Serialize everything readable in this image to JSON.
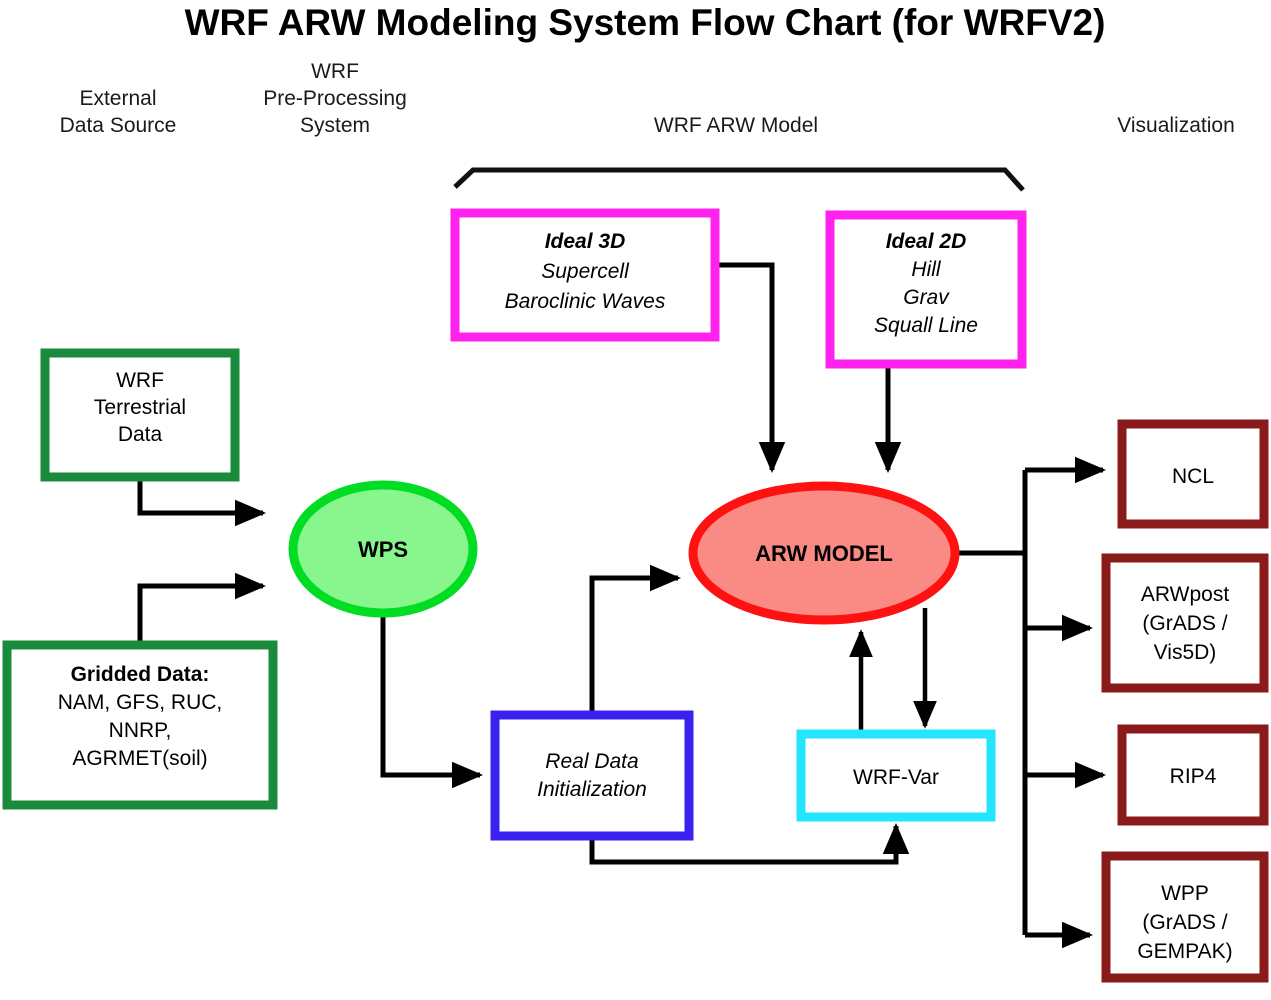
{
  "title": "WRF ARW Modeling System Flow Chart (for WRFV2)",
  "columns": [
    {
      "id": "external-data-source",
      "lines": [
        "External",
        "Data Source"
      ]
    },
    {
      "id": "wrf-pre-processing-system",
      "lines": [
        "WRF",
        "Pre-Processing",
        "System"
      ]
    },
    {
      "id": "wrf-arw-model",
      "lines": [
        "WRF ARW Model"
      ]
    },
    {
      "id": "visualization",
      "lines": [
        "Visualization"
      ]
    }
  ],
  "nodes": {
    "wrf_terrestrial_data": {
      "label": "WRF Terrestrial Data",
      "lines": [
        "WRF",
        "Terrestrial",
        "Data"
      ],
      "shape": "box",
      "border_color": "#1a8a3d",
      "fill_color": "#ffffff",
      "text_color": "#000000"
    },
    "gridded_data": {
      "label": "Gridded Data",
      "lines": [
        "Gridded Data:",
        "NAM, GFS, RUC,",
        "NNRP,",
        "AGRMET(soil)"
      ],
      "bold_lines": [
        0
      ],
      "shape": "box",
      "border_color": "#1a8a3d",
      "fill_color": "#ffffff",
      "text_color": "#000000"
    },
    "wps": {
      "label": "WPS",
      "lines": [
        "WPS"
      ],
      "shape": "ellipse",
      "border_color": "#00dd22",
      "fill_color": "#88f58d",
      "text_color": "#000000"
    },
    "ideal_3d": {
      "label": "Ideal 3D",
      "lines": [
        "Ideal 3D",
        "Supercell",
        "Baroclinic Waves"
      ],
      "bold_lines": [
        0
      ],
      "italic": true,
      "shape": "box",
      "border_color": "#ff22ee",
      "fill_color": "#ffffff",
      "text_color": "#000000"
    },
    "ideal_2d": {
      "label": "Ideal 2D",
      "lines": [
        "Ideal 2D",
        "Hill",
        "Grav",
        "Squall Line"
      ],
      "bold_lines": [
        0
      ],
      "italic": true,
      "shape": "box",
      "border_color": "#ff22ee",
      "fill_color": "#ffffff",
      "text_color": "#000000"
    },
    "arw_model": {
      "label": "ARW MODEL",
      "lines": [
        "ARW MODEL"
      ],
      "shape": "ellipse",
      "border_color": "#ff1111",
      "fill_color": "#fa8a84",
      "text_color": "#000000"
    },
    "real_data_initialization": {
      "label": "Real Data Initialization",
      "lines": [
        "Real Data",
        "Initialization"
      ],
      "italic": true,
      "shape": "box",
      "border_color": "#3a22ee",
      "fill_color": "#ffffff",
      "text_color": "#000000"
    },
    "wrf_var": {
      "label": "WRF-Var",
      "lines": [
        "WRF-Var"
      ],
      "shape": "box",
      "border_color": "#22e5ff",
      "fill_color": "#ffffff",
      "text_color": "#000000"
    },
    "ncl": {
      "label": "NCL",
      "lines": [
        "NCL"
      ],
      "shape": "box",
      "border_color": "#8b1a1a",
      "fill_color": "#ffffff",
      "text_color": "#000000"
    },
    "arwpost": {
      "label": "ARWpost",
      "lines": [
        "ARWpost",
        "(GrADS /",
        "Vis5D)"
      ],
      "shape": "box",
      "border_color": "#8b1a1a",
      "fill_color": "#ffffff",
      "text_color": "#000000"
    },
    "rip4": {
      "label": "RIP4",
      "lines": [
        "RIP4"
      ],
      "shape": "box",
      "border_color": "#8b1a1a",
      "fill_color": "#ffffff",
      "text_color": "#000000"
    },
    "wpp": {
      "label": "WPP",
      "lines": [
        "WPP",
        "(GrADS /",
        "GEMPAK)"
      ],
      "shape": "box",
      "border_color": "#8b1a1a",
      "fill_color": "#ffffff",
      "text_color": "#000000"
    }
  },
  "edges": [
    {
      "from": "wrf_terrestrial_data",
      "to": "wps"
    },
    {
      "from": "gridded_data",
      "to": "wps"
    },
    {
      "from": "wps",
      "to": "real_data_initialization"
    },
    {
      "from": "real_data_initialization",
      "to": "arw_model"
    },
    {
      "from": "real_data_initialization",
      "to": "wrf_var"
    },
    {
      "from": "ideal_3d",
      "to": "arw_model"
    },
    {
      "from": "ideal_2d",
      "to": "arw_model"
    },
    {
      "from": "arw_model",
      "to": "wrf_var"
    },
    {
      "from": "wrf_var",
      "to": "arw_model"
    },
    {
      "from": "arw_model",
      "to": "ncl"
    },
    {
      "from": "arw_model",
      "to": "arwpost"
    },
    {
      "from": "arw_model",
      "to": "rip4"
    },
    {
      "from": "arw_model",
      "to": "wpp"
    }
  ]
}
